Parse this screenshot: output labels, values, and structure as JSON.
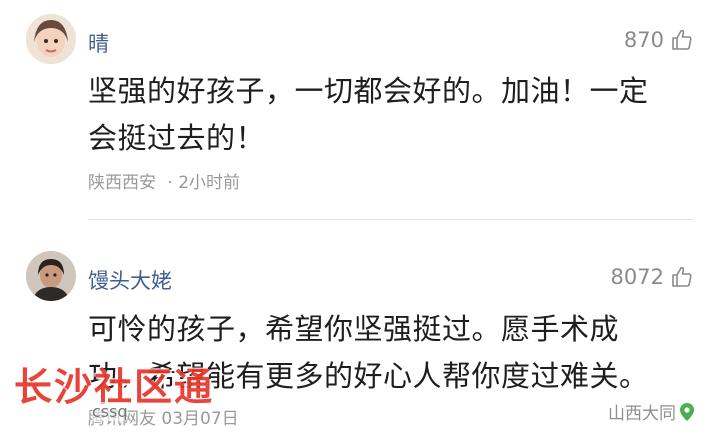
{
  "comments": [
    {
      "username": "晴",
      "likes": "870",
      "text_line1": "坚强的好孩子，一切都会好的。加油！一定",
      "text_line2": "会挺过去的！",
      "location": "陕西西安",
      "time": "· 2小时前"
    },
    {
      "username": "馒头大姥",
      "likes": "8072",
      "text_line1": "可怜的孩子，希望你坚强挺过。愿手术成",
      "text_line2": "功。希望能有更多的好心人帮你度过难关。",
      "meta": "腾讯网友  03月07日",
      "location": "山西大同"
    }
  ],
  "watermark": {
    "text": "长沙社区通",
    "sub": "cssq"
  },
  "colors": {
    "username": "#3f5f8c",
    "watermark": "#e8352a",
    "location_pin": "#4caf50"
  },
  "icons": [
    "thumbs-up-icon",
    "location-pin-icon"
  ]
}
